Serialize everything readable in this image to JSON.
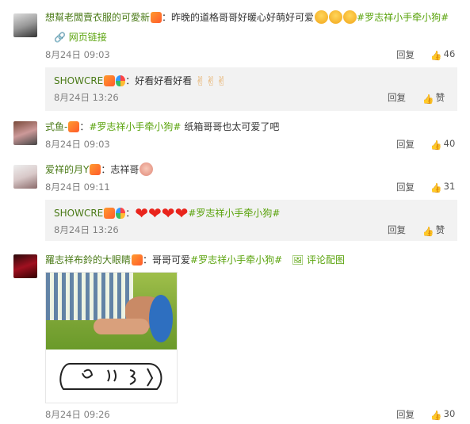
{
  "comments": [
    {
      "user": "想幫老闆賣衣服的可愛新",
      "text": "：昨晚的道格哥哥好暖心好萌好可爱",
      "topic": "#罗志祥小手牵小狗#",
      "link_label": "网页链接",
      "time": "8月24日 09:03",
      "reply_label": "回复",
      "likes": "46",
      "reply": {
        "user": "SHOWCRE",
        "text": "：好看好看好看",
        "time": "8月24日 13:26",
        "reply_label": "回复",
        "like_label": "赞"
      }
    },
    {
      "user": "式鱼-",
      "text": "纸箱哥哥也太可爱了吧",
      "topic": "#罗志祥小手牵小狗#",
      "time": "8月24日 09:03",
      "reply_label": "回复",
      "likes": "40"
    },
    {
      "user": "爱祥的月Y",
      "text": "：志祥哥",
      "time": "8月24日 09:11",
      "reply_label": "回复",
      "likes": "31",
      "reply": {
        "user": "SHOWCRE",
        "text": "：",
        "topic": "#罗志祥小手牵小狗#",
        "time": "8月24日 13:26",
        "reply_label": "回复",
        "like_label": "赞"
      }
    },
    {
      "user": "羅志祥布鈴的大眼睛",
      "text": "：哥哥可爱",
      "topic": "#罗志祥小手牵小狗#",
      "pic_label": "评论配图",
      "time": "8月24日 09:26",
      "reply_label": "回复",
      "likes": "30"
    }
  ],
  "colors": {
    "username": "#4a7a17",
    "topic": "#5aa30c",
    "reply_bg": "#f2f2f2"
  }
}
